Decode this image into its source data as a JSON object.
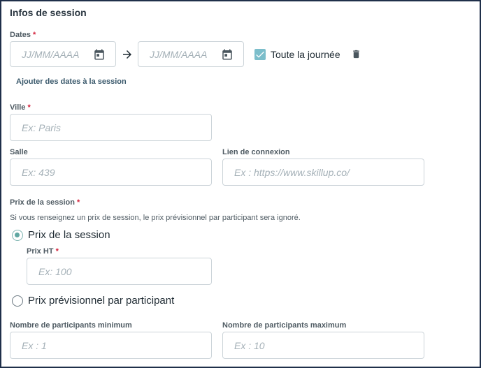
{
  "section": {
    "title": "Infos de session"
  },
  "dates": {
    "label": "Dates",
    "required_mark": "*",
    "start_placeholder": "JJ/MM/AAAA",
    "end_placeholder": "JJ/MM/AAAA",
    "all_day_label": "Toute la journée",
    "all_day_checked": true,
    "add_dates_link": "Ajouter des dates à la session"
  },
  "ville": {
    "label": "Ville",
    "required_mark": "*",
    "placeholder": "Ex: Paris"
  },
  "salle": {
    "label": "Salle",
    "placeholder": "Ex: 439"
  },
  "lien": {
    "label": "Lien de connexion",
    "placeholder": "Ex : https://www.skillup.co/"
  },
  "prix": {
    "label": "Prix de la session",
    "required_mark": "*",
    "helper": "Si vous renseignez un prix de session, le prix prévisionnel par participant sera ignoré.",
    "option_session": "Prix de la session",
    "option_participant": "Prix prévisionnel par participant",
    "selected": "session",
    "ht_label": "Prix HT",
    "ht_required_mark": "*",
    "ht_placeholder": "Ex: 100"
  },
  "participants": {
    "min_label": "Nombre de participants minimum",
    "min_placeholder": "Ex : 1",
    "max_label": "Nombre de participants maximum",
    "max_placeholder": "Ex : 10"
  },
  "icons": {
    "calendar": "calendar-icon",
    "arrow": "arrow-right-icon",
    "trash": "trash-icon",
    "check": "check-icon"
  },
  "colors": {
    "accent": "#5fa7a2",
    "checkbox": "#7cbecb",
    "required": "#d3203a",
    "border": "#ccd4d9",
    "link": "#39586b"
  }
}
